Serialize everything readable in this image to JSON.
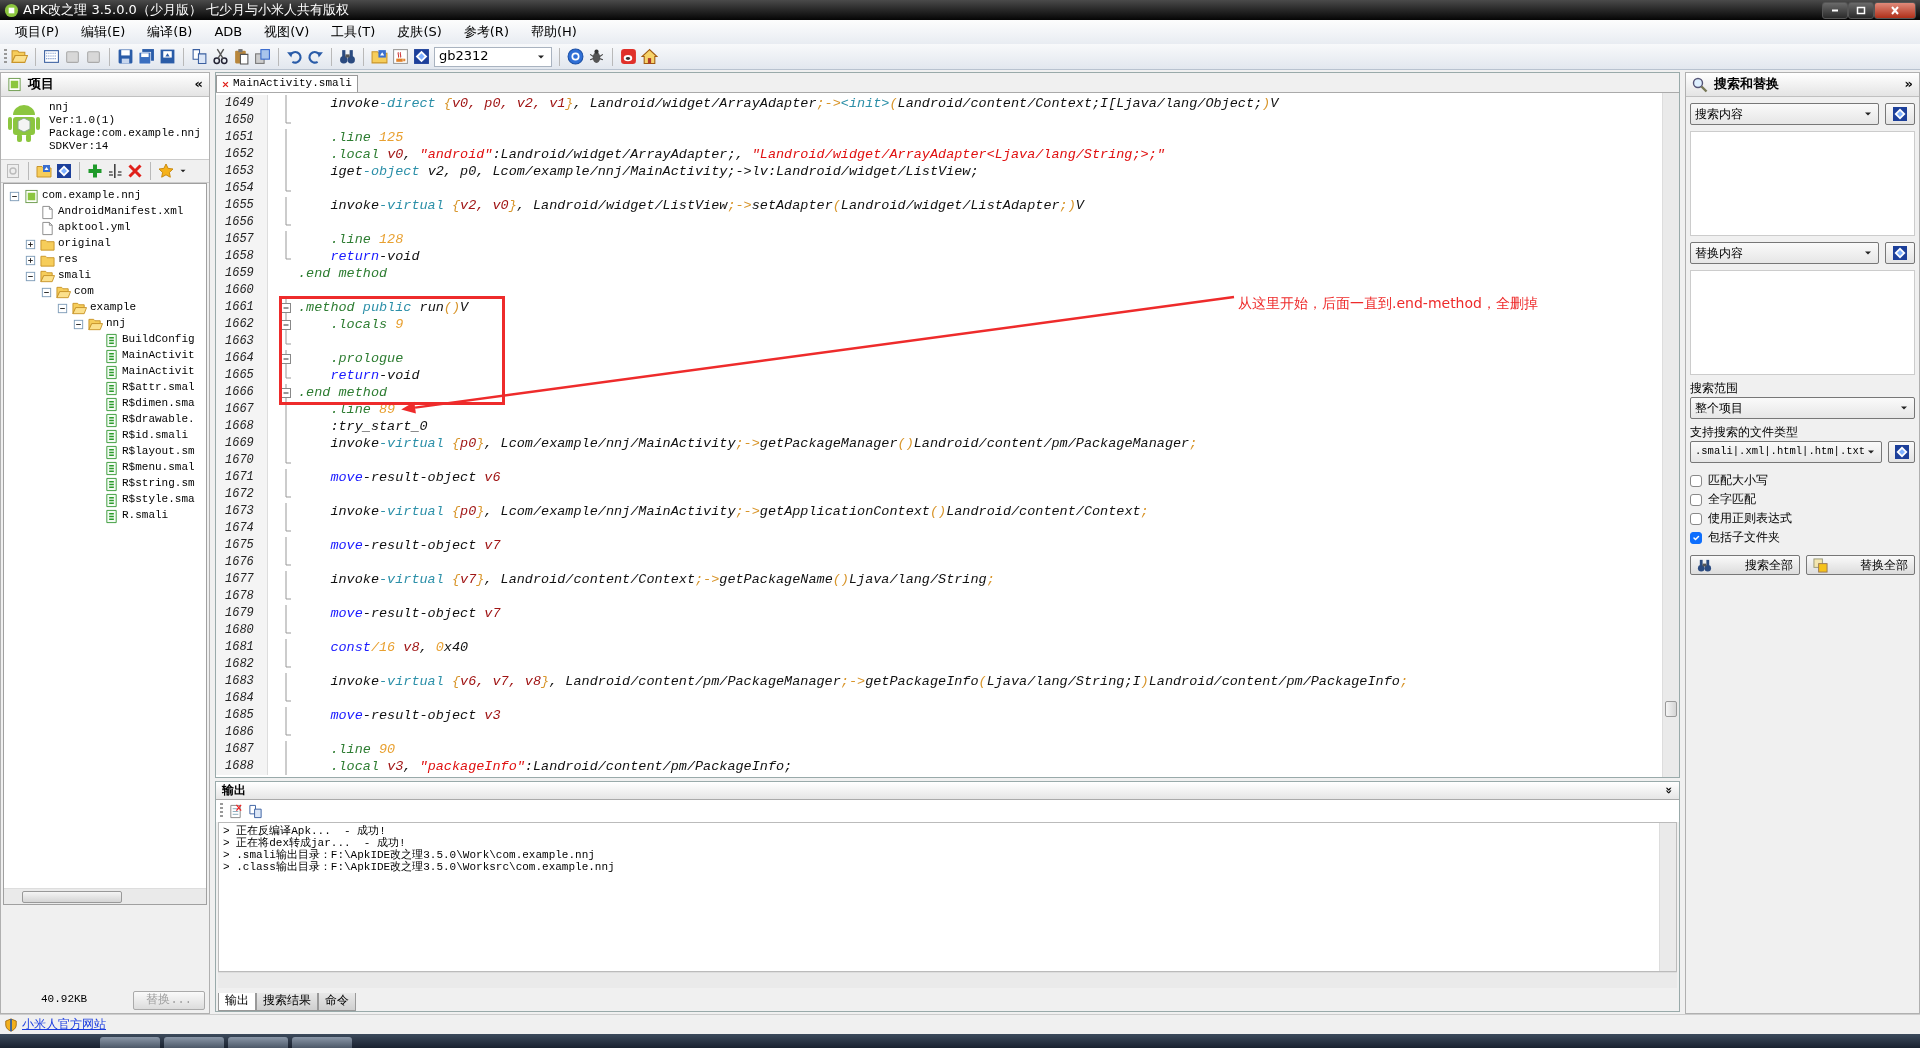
{
  "window": {
    "title": "APK改之理 3.5.0.0（少月版） 七少月与小米人共有版权"
  },
  "menu": [
    "项目(P)",
    "编辑(E)",
    "编译(B)",
    "ADB",
    "视图(V)",
    "工具(T)",
    "皮肤(S)",
    "参考(R)",
    "帮助(H)"
  ],
  "toolbar": {
    "encoding": "gb2312"
  },
  "project_panel": {
    "title": "项目",
    "collapse": "«",
    "info": [
      "nnj",
      "Ver:1.0(1)",
      "Package:com.example.nnj",
      "SDKVer:14"
    ],
    "tree": [
      {
        "label": "com.example.nnj",
        "kind": "project",
        "expanded": true,
        "children": [
          {
            "label": "AndroidManifest.xml",
            "kind": "file"
          },
          {
            "label": "apktool.yml",
            "kind": "file"
          },
          {
            "label": "original",
            "kind": "folder",
            "expanded": false
          },
          {
            "label": "res",
            "kind": "folder",
            "expanded": false
          },
          {
            "label": "smali",
            "kind": "folder",
            "expanded": true,
            "children": [
              {
                "label": "com",
                "kind": "folder",
                "expanded": true,
                "children": [
                  {
                    "label": "example",
                    "kind": "folder",
                    "expanded": true,
                    "children": [
                      {
                        "label": "nnj",
                        "kind": "folder",
                        "expanded": true,
                        "children": [
                          {
                            "label": "BuildConfig",
                            "kind": "smali"
                          },
                          {
                            "label": "MainActivit",
                            "kind": "smali"
                          },
                          {
                            "label": "MainActivit",
                            "kind": "smali"
                          },
                          {
                            "label": "R$attr.smal",
                            "kind": "smali"
                          },
                          {
                            "label": "R$dimen.sma",
                            "kind": "smali"
                          },
                          {
                            "label": "R$drawable.",
                            "kind": "smali"
                          },
                          {
                            "label": "R$id.smali",
                            "kind": "smali"
                          },
                          {
                            "label": "R$layout.sm",
                            "kind": "smali"
                          },
                          {
                            "label": "R$menu.smal",
                            "kind": "smali"
                          },
                          {
                            "label": "R$string.sm",
                            "kind": "smali"
                          },
                          {
                            "label": "R$style.sma",
                            "kind": "smali"
                          },
                          {
                            "label": "R.smali",
                            "kind": "smali"
                          }
                        ]
                      }
                    ]
                  }
                ]
              }
            ]
          }
        ]
      }
    ],
    "size": "40.92KB",
    "replace_button": "替换..."
  },
  "editor": {
    "tab": "MainActivity.smali",
    "lines": [
      {
        "num": "1649",
        "fold": {
          "kind": "bar"
        },
        "tokens": [
          {
            "kind": "plain",
            "text": "    invoke"
          },
          {
            "kind": "accent",
            "text": "-direct "
          },
          {
            "kind": "punct",
            "text": "{"
          },
          {
            "kind": "register",
            "text": "v0, p0, v2, v1"
          },
          {
            "kind": "punct",
            "text": "}"
          },
          {
            "kind": "plain",
            "text": ", Landroid/widget/ArrayAdapter"
          },
          {
            "kind": "punct",
            "text": ";->"
          },
          {
            "kind": "accent",
            "text": "<init>"
          },
          {
            "kind": "punct",
            "text": "("
          },
          {
            "kind": "plain",
            "text": "Landroid/content/Context;I[Ljava/lang/Object;"
          },
          {
            "kind": "punct",
            "text": ")"
          },
          {
            "kind": "plain",
            "text": "V"
          }
        ]
      },
      {
        "num": "1650",
        "fold": {
          "kind": "end"
        }
      },
      {
        "num": "1651",
        "fold": {
          "kind": "bar"
        },
        "tokens": [
          {
            "kind": "directive",
            "text": "    .line "
          },
          {
            "kind": "number",
            "text": "125"
          }
        ]
      },
      {
        "num": "1652",
        "fold": {
          "kind": "bar"
        },
        "tokens": [
          {
            "kind": "directive",
            "text": "    .local "
          },
          {
            "kind": "register",
            "text": "v0"
          },
          {
            "kind": "plain",
            "text": ", "
          },
          {
            "kind": "string",
            "text": "\"android\""
          },
          {
            "kind": "plain",
            "text": ":Landroid/widget/ArrayAdapter;, "
          },
          {
            "kind": "string",
            "text": "\"Landroid/widget/ArrayAdapter<Ljava/lang/String;>;\""
          }
        ]
      },
      {
        "num": "1653",
        "fold": {
          "kind": "bar"
        },
        "tokens": [
          {
            "kind": "plain",
            "text": "    iget"
          },
          {
            "kind": "accent",
            "text": "-object "
          },
          {
            "kind": "plain",
            "text": "v2, p0, Lcom/example/nnj/MainActivity;->lv:Landroid/widget/ListView;"
          }
        ]
      },
      {
        "num": "1654",
        "fold": {
          "kind": "end"
        }
      },
      {
        "num": "1655",
        "fold": {
          "kind": "bar"
        },
        "tokens": [
          {
            "kind": "plain",
            "text": "    invoke"
          },
          {
            "kind": "accent",
            "text": "-virtual "
          },
          {
            "kind": "punct",
            "text": "{"
          },
          {
            "kind": "register",
            "text": "v2, v0"
          },
          {
            "kind": "punct",
            "text": "}"
          },
          {
            "kind": "plain",
            "text": ", Landroid/widget/ListView"
          },
          {
            "kind": "punct",
            "text": ";->"
          },
          {
            "kind": "plain",
            "text": "setAdapter"
          },
          {
            "kind": "punct",
            "text": "("
          },
          {
            "kind": "plain",
            "text": "Landroid/widget/ListAdapter"
          },
          {
            "kind": "punct",
            "text": ";)"
          },
          {
            "kind": "plain",
            "text": "V"
          }
        ]
      },
      {
        "num": "1656",
        "fold": {
          "kind": "end"
        }
      },
      {
        "num": "1657",
        "fold": {
          "kind": "bar"
        },
        "tokens": [
          {
            "kind": "directive",
            "text": "    .line "
          },
          {
            "kind": "number",
            "text": "128"
          }
        ]
      },
      {
        "num": "1658",
        "fold": {
          "kind": "end"
        },
        "tokens": [
          {
            "kind": "keyword",
            "text": "    return"
          },
          {
            "kind": "plain",
            "text": "-void"
          }
        ]
      },
      {
        "num": "1659",
        "tokens": [
          {
            "kind": "directive",
            "text": ".end method"
          }
        ]
      },
      {
        "num": "1660"
      },
      {
        "num": "1661",
        "fold": {
          "kind": "box"
        },
        "boxed": true,
        "tokens": [
          {
            "kind": "directive",
            "text": ".method "
          },
          {
            "kind": "accent",
            "text": "public "
          },
          {
            "kind": "plain",
            "text": "run"
          },
          {
            "kind": "punct",
            "text": "()"
          },
          {
            "kind": "plain",
            "text": "V"
          }
        ]
      },
      {
        "num": "1662",
        "fold": {
          "kind": "box"
        },
        "boxed": true,
        "tokens": [
          {
            "kind": "directive",
            "text": "    .locals "
          },
          {
            "kind": "number",
            "text": "9"
          }
        ]
      },
      {
        "num": "1663",
        "fold": {
          "kind": "end"
        },
        "boxed": true
      },
      {
        "num": "1664",
        "fold": {
          "kind": "box"
        },
        "boxed": true,
        "tokens": [
          {
            "kind": "directive",
            "text": "    .prologue"
          }
        ]
      },
      {
        "num": "1665",
        "fold": {
          "kind": "end"
        },
        "boxed": true,
        "tokens": [
          {
            "kind": "keyword",
            "text": "    return"
          },
          {
            "kind": "plain",
            "text": "-void"
          }
        ]
      },
      {
        "num": "1666",
        "fold": {
          "kind": "box"
        },
        "boxed": true,
        "tokens": [
          {
            "kind": "directive",
            "text": ".end method"
          }
        ]
      },
      {
        "num": "1667",
        "fold": {
          "kind": "bar"
        },
        "arrow_target": true,
        "tokens": [
          {
            "kind": "directive",
            "text": "    .line "
          },
          {
            "kind": "number",
            "text": "89"
          }
        ]
      },
      {
        "num": "1668",
        "fold": {
          "kind": "bar"
        },
        "tokens": [
          {
            "kind": "plain",
            "text": "    :try_start_0"
          }
        ]
      },
      {
        "num": "1669",
        "fold": {
          "kind": "bar"
        },
        "tokens": [
          {
            "kind": "plain",
            "text": "    invoke"
          },
          {
            "kind": "accent",
            "text": "-virtual "
          },
          {
            "kind": "punct",
            "text": "{"
          },
          {
            "kind": "register",
            "text": "p0"
          },
          {
            "kind": "punct",
            "text": "}"
          },
          {
            "kind": "plain",
            "text": ", Lcom/example/nnj/MainActivity"
          },
          {
            "kind": "punct",
            "text": ";->"
          },
          {
            "kind": "plain",
            "text": "getPackageManager"
          },
          {
            "kind": "punct",
            "text": "()"
          },
          {
            "kind": "plain",
            "text": "Landroid/content/pm/PackageManager"
          },
          {
            "kind": "punct",
            "text": ";"
          }
        ]
      },
      {
        "num": "1670",
        "fold": {
          "kind": "end"
        }
      },
      {
        "num": "1671",
        "fold": {
          "kind": "bar"
        },
        "tokens": [
          {
            "kind": "keyword",
            "text": "    move"
          },
          {
            "kind": "plain",
            "text": "-result-object "
          },
          {
            "kind": "register",
            "text": "v6"
          }
        ]
      },
      {
        "num": "1672",
        "fold": {
          "kind": "end"
        }
      },
      {
        "num": "1673",
        "fold": {
          "kind": "bar"
        },
        "tokens": [
          {
            "kind": "plain",
            "text": "    invoke"
          },
          {
            "kind": "accent",
            "text": "-virtual "
          },
          {
            "kind": "punct",
            "text": "{"
          },
          {
            "kind": "register",
            "text": "p0"
          },
          {
            "kind": "punct",
            "text": "}"
          },
          {
            "kind": "plain",
            "text": ", Lcom/example/nnj/MainActivity"
          },
          {
            "kind": "punct",
            "text": ";->"
          },
          {
            "kind": "plain",
            "text": "getApplicationContext"
          },
          {
            "kind": "punct",
            "text": "()"
          },
          {
            "kind": "plain",
            "text": "Landroid/content/Context"
          },
          {
            "kind": "punct",
            "text": ";"
          }
        ]
      },
      {
        "num": "1674",
        "fold": {
          "kind": "end"
        }
      },
      {
        "num": "1675",
        "fold": {
          "kind": "bar"
        },
        "tokens": [
          {
            "kind": "keyword",
            "text": "    move"
          },
          {
            "kind": "plain",
            "text": "-result-object "
          },
          {
            "kind": "register",
            "text": "v7"
          }
        ]
      },
      {
        "num": "1676",
        "fold": {
          "kind": "end"
        }
      },
      {
        "num": "1677",
        "fold": {
          "kind": "bar"
        },
        "tokens": [
          {
            "kind": "plain",
            "text": "    invoke"
          },
          {
            "kind": "accent",
            "text": "-virtual "
          },
          {
            "kind": "punct",
            "text": "{"
          },
          {
            "kind": "register",
            "text": "v7"
          },
          {
            "kind": "punct",
            "text": "}"
          },
          {
            "kind": "plain",
            "text": ", Landroid/content/Context"
          },
          {
            "kind": "punct",
            "text": ";->"
          },
          {
            "kind": "plain",
            "text": "getPackageName"
          },
          {
            "kind": "punct",
            "text": "()"
          },
          {
            "kind": "plain",
            "text": "Ljava/lang/String"
          },
          {
            "kind": "punct",
            "text": ";"
          }
        ]
      },
      {
        "num": "1678",
        "fold": {
          "kind": "end"
        }
      },
      {
        "num": "1679",
        "fold": {
          "kind": "bar"
        },
        "tokens": [
          {
            "kind": "keyword",
            "text": "    move"
          },
          {
            "kind": "plain",
            "text": "-result-object "
          },
          {
            "kind": "register",
            "text": "v7"
          }
        ]
      },
      {
        "num": "1680",
        "fold": {
          "kind": "end"
        }
      },
      {
        "num": "1681",
        "fold": {
          "kind": "bar"
        },
        "tokens": [
          {
            "kind": "keyword",
            "text": "    const"
          },
          {
            "kind": "number",
            "text": "/16 "
          },
          {
            "kind": "register",
            "text": "v8"
          },
          {
            "kind": "plain",
            "text": ", "
          },
          {
            "kind": "number",
            "text": "0"
          },
          {
            "kind": "plain",
            "text": "x40"
          }
        ]
      },
      {
        "num": "1682",
        "fold": {
          "kind": "end"
        }
      },
      {
        "num": "1683",
        "fold": {
          "kind": "bar"
        },
        "tokens": [
          {
            "kind": "plain",
            "text": "    invoke"
          },
          {
            "kind": "accent",
            "text": "-virtual "
          },
          {
            "kind": "punct",
            "text": "{"
          },
          {
            "kind": "register",
            "text": "v6, v7, v8"
          },
          {
            "kind": "punct",
            "text": "}"
          },
          {
            "kind": "plain",
            "text": ", Landroid/content/pm/PackageManager"
          },
          {
            "kind": "punct",
            "text": ";->"
          },
          {
            "kind": "plain",
            "text": "getPackageInfo"
          },
          {
            "kind": "punct",
            "text": "("
          },
          {
            "kind": "plain",
            "text": "Ljava/lang/String;I"
          },
          {
            "kind": "punct",
            "text": ")"
          },
          {
            "kind": "plain",
            "text": "Landroid/content/pm/PackageInfo"
          },
          {
            "kind": "punct",
            "text": ";"
          }
        ]
      },
      {
        "num": "1684",
        "fold": {
          "kind": "end"
        }
      },
      {
        "num": "1685",
        "fold": {
          "kind": "bar"
        },
        "tokens": [
          {
            "kind": "keyword",
            "text": "    move"
          },
          {
            "kind": "plain",
            "text": "-result-object "
          },
          {
            "kind": "register",
            "text": "v3"
          }
        ]
      },
      {
        "num": "1686",
        "fold": {
          "kind": "end"
        }
      },
      {
        "num": "1687",
        "fold": {
          "kind": "bar"
        },
        "tokens": [
          {
            "kind": "directive",
            "text": "    .line "
          },
          {
            "kind": "number",
            "text": "90"
          }
        ]
      },
      {
        "num": "1688",
        "fold": {
          "kind": "bar"
        },
        "tokens": [
          {
            "kind": "directive",
            "text": "    .local "
          },
          {
            "kind": "register",
            "text": "v3"
          },
          {
            "kind": "plain",
            "text": ", "
          },
          {
            "kind": "string",
            "text": "\"packageInfo\""
          },
          {
            "kind": "plain",
            "text": ":Landroid/content/pm/PackageInfo;"
          }
        ]
      }
    ],
    "annotation": {
      "text": "从这里开始，后面一直到.end-method，全删掉"
    }
  },
  "output": {
    "title": "输出",
    "collapse": "»",
    "log": [
      "> 正在反编译Apk...  - 成功!",
      "> 正在将dex转成jar...  - 成功!",
      "> .smali输出目录：F:\\ApkIDE改之理3.5.0\\Work\\com.example.nnj",
      "> .class输出目录：F:\\ApkIDE改之理3.5.0\\Worksrc\\com.example.nnj"
    ],
    "tabs": [
      {
        "label": "输出",
        "selected": true
      },
      {
        "label": "搜索结果",
        "selected": false
      },
      {
        "label": "命令",
        "selected": false
      }
    ]
  },
  "search_panel": {
    "title": "搜索和替换",
    "collapse": "»",
    "search_field": {
      "placeholder": "搜索内容"
    },
    "replace_field": {
      "placeholder": "替换内容"
    },
    "scope_label": "搜索范围",
    "scope": "整个项目",
    "types_label": "支持搜索的文件类型",
    "types": ".smali|.xml|.html|.htm|.txt",
    "options": [
      {
        "label": "匹配大小写",
        "checked": false
      },
      {
        "label": "全字匹配",
        "checked": false
      },
      {
        "label": "使用正则表达式",
        "checked": false
      },
      {
        "label": "包括子文件夹",
        "checked": true
      }
    ],
    "buttons": [
      {
        "label": "搜索全部",
        "kind": "search"
      },
      {
        "label": "替换全部",
        "kind": "replace"
      }
    ]
  },
  "status_bar": {
    "link": "小米人官方网站"
  }
}
